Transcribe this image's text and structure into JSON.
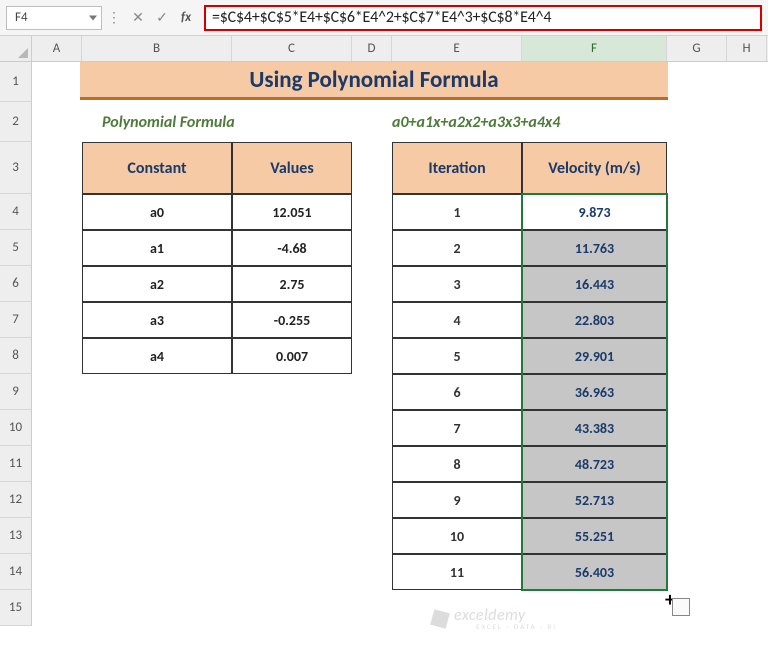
{
  "namebox": "F4",
  "formula": "=$C$4+$C$5*E4+$C$6*E4^2+$C$7*E4^3+$C$8*E4^4",
  "columns": [
    "A",
    "B",
    "C",
    "D",
    "E",
    "F",
    "G",
    "H"
  ],
  "selected_col": "F",
  "row_labels": [
    "1",
    "2",
    "3",
    "4",
    "5",
    "6",
    "7",
    "8",
    "9",
    "10",
    "11",
    "12",
    "13",
    "14",
    "15"
  ],
  "title": "Using Polynomial Formula",
  "subtitle_left": "Polynomial Formula",
  "subtitle_right": "a0+a1x+a2x2+a3x3+a4x4",
  "constants_headers": [
    "Constant",
    "Values"
  ],
  "constants": [
    {
      "name": "a0",
      "value": "12.051"
    },
    {
      "name": "a1",
      "value": "-4.68"
    },
    {
      "name": "a2",
      "value": "2.75"
    },
    {
      "name": "a3",
      "value": "-0.255"
    },
    {
      "name": "a4",
      "value": "0.007"
    }
  ],
  "results_headers": [
    "Iteration",
    "Velocity (m/s)"
  ],
  "results": [
    {
      "iter": "1",
      "vel": "9.873",
      "sel": false
    },
    {
      "iter": "2",
      "vel": "11.763",
      "sel": true
    },
    {
      "iter": "3",
      "vel": "16.443",
      "sel": true
    },
    {
      "iter": "4",
      "vel": "22.803",
      "sel": true
    },
    {
      "iter": "5",
      "vel": "29.901",
      "sel": true
    },
    {
      "iter": "6",
      "vel": "36.963",
      "sel": true
    },
    {
      "iter": "7",
      "vel": "43.383",
      "sel": true
    },
    {
      "iter": "8",
      "vel": "48.723",
      "sel": true
    },
    {
      "iter": "9",
      "vel": "52.713",
      "sel": true
    },
    {
      "iter": "10",
      "vel": "55.251",
      "sel": true
    },
    {
      "iter": "11",
      "vel": "56.403",
      "sel": true
    }
  ],
  "watermark": {
    "brand": "exceldemy",
    "tag": "EXCEL · DATA · BI"
  }
}
